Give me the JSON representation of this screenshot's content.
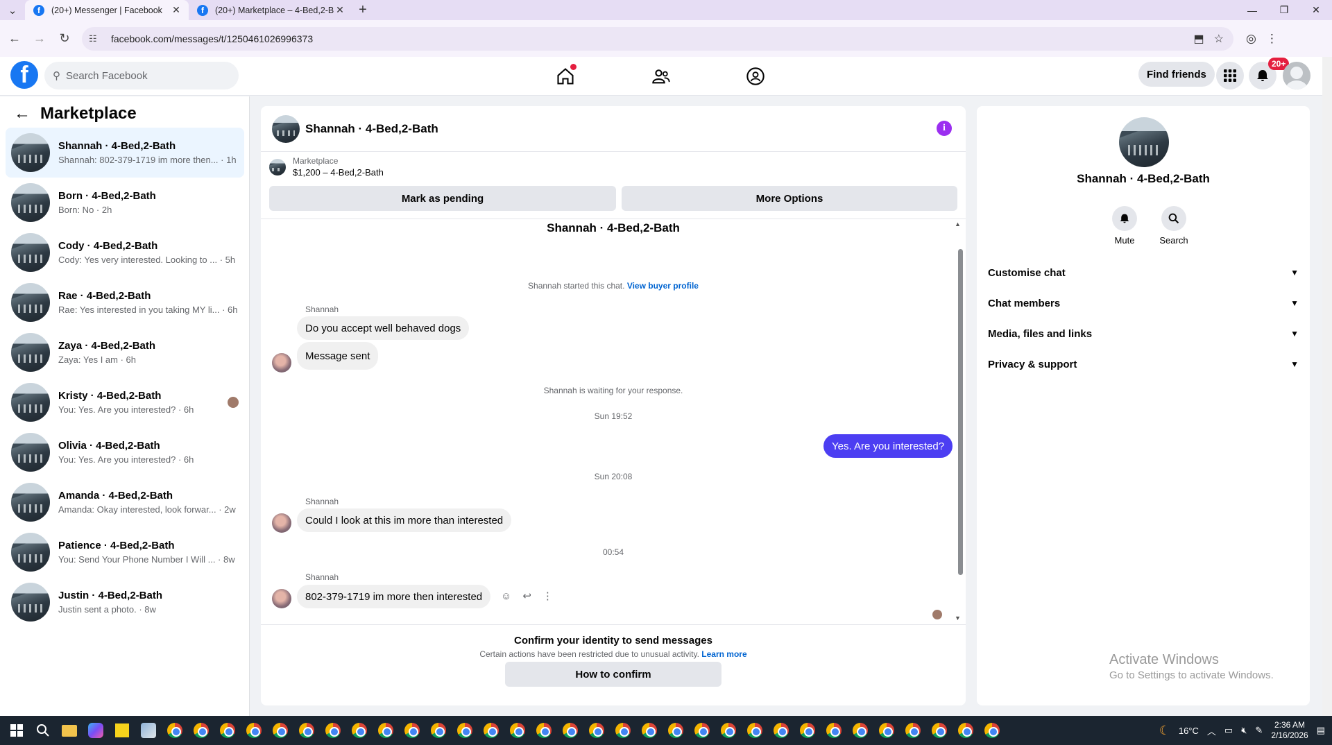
{
  "browser": {
    "tabs": [
      {
        "title": "(20+) Messenger | Facebook",
        "active": true
      },
      {
        "title": "(20+) Marketplace – 4-Bed,2-B",
        "active": false
      }
    ],
    "url": "facebook.com/messages/t/1250461026996373"
  },
  "fb": {
    "search_placeholder": "Search Facebook",
    "find_friends": "Find friends",
    "notif_badge": "20+"
  },
  "sidebar": {
    "title": "Marketplace",
    "conversations": [
      {
        "name": "Shannah · 4-Bed,2-Bath",
        "preview": "Shannah: 802-379-1719 im more then... · 1h",
        "active": true
      },
      {
        "name": "Born · 4-Bed,2-Bath",
        "preview": "Born: No · 2h"
      },
      {
        "name": "Cody · 4-Bed,2-Bath",
        "preview": "Cody: Yes very interested. Looking to ... · 5h"
      },
      {
        "name": "Rae · 4-Bed,2-Bath",
        "preview": "Rae: Yes interested in you taking MY li... · 6h"
      },
      {
        "name": "Zaya · 4-Bed,2-Bath",
        "preview": "Zaya: Yes I am · 6h"
      },
      {
        "name": "Kristy · 4-Bed,2-Bath",
        "preview": "You: Yes. Are you interested? · 6h"
      },
      {
        "name": "Olivia · 4-Bed,2-Bath",
        "preview": "You: Yes. Are you interested? · 6h"
      },
      {
        "name": "Amanda · 4-Bed,2-Bath",
        "preview": "Amanda: Okay interested, look forwar... · 2w"
      },
      {
        "name": "Patience · 4-Bed,2-Bath",
        "preview": "You: Send Your Phone Number I Will ... · 8w"
      },
      {
        "name": "Justin · 4-Bed,2-Bath",
        "preview": "Justin sent a photo. · 8w"
      }
    ]
  },
  "chat": {
    "header_name": "Shannah · 4-Bed,2-Bath",
    "marketplace_label": "Marketplace",
    "listing": "$1,200 – 4-Bed,2-Bath",
    "mark_pending": "Mark as pending",
    "more_options": "More Options",
    "conv_title": "Shannah · 4-Bed,2-Bath",
    "started_text": "Shannah started this chat.",
    "view_profile": "View buyer profile",
    "sender": "Shannah",
    "msg1": "Do you accept well behaved dogs",
    "msg2": "Message sent",
    "waiting": "Shannah is waiting for your response.",
    "time1": "Sun 19:52",
    "msg_out": "Yes. Are you interested?",
    "time2": "Sun 20:08",
    "msg3": "Could I look at this im more than interested",
    "time3": "00:54",
    "msg4": "802-379-1719  im more then interested",
    "restrict_title": "Confirm your identity to send messages",
    "restrict_text": "Certain actions have been restricted due to unusual activity.",
    "learn_more": "Learn more",
    "how_confirm": "How to confirm"
  },
  "info_panel": {
    "name": "Shannah · 4-Bed,2-Bath",
    "mute": "Mute",
    "search": "Search",
    "sections": [
      "Customise chat",
      "Chat members",
      "Media, files and links",
      "Privacy & support"
    ]
  },
  "watermark": {
    "line1": "Activate Windows",
    "line2": "Go to Settings to activate Windows."
  },
  "taskbar": {
    "temp": "16°C",
    "time": "2:36 AM",
    "date": "2/16/2026"
  },
  "colors": {
    "fb_blue": "#1877f2",
    "outgoing_bubble": "#4c3ef2",
    "info_purple": "#9b2ff0",
    "badge_red": "#e41e3f"
  }
}
